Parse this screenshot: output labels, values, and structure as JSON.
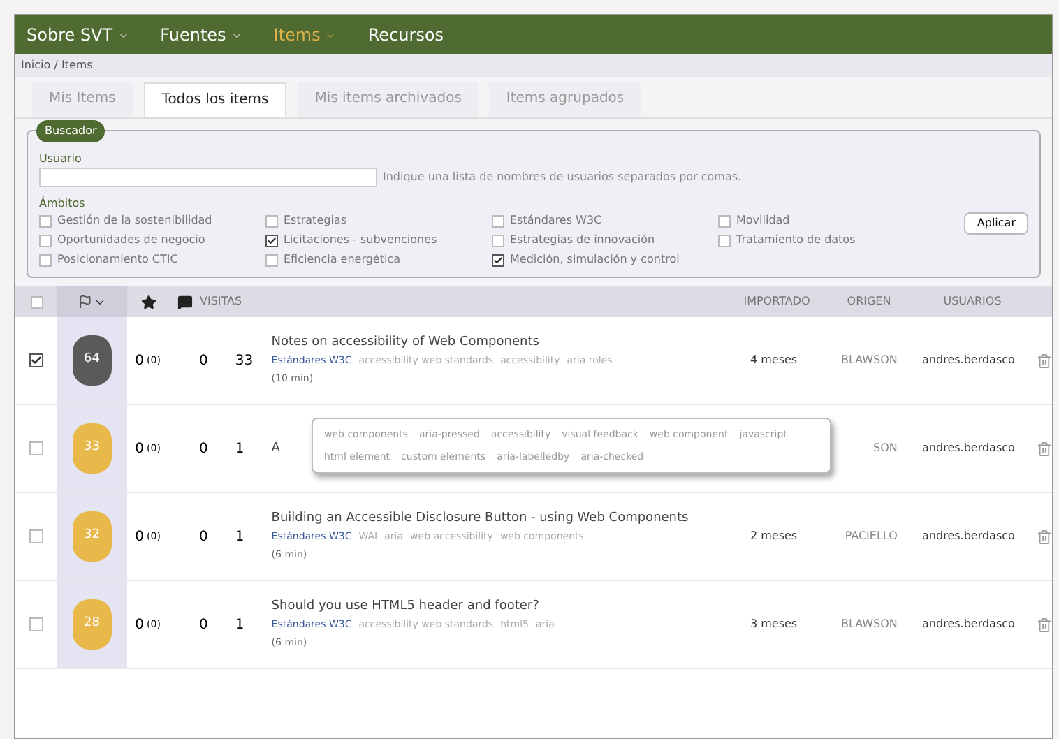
{
  "nav": [
    {
      "label": "Sobre SVT",
      "dropdown": true,
      "selected": false
    },
    {
      "label": "Fuentes",
      "dropdown": true,
      "selected": false
    },
    {
      "label": "Items",
      "dropdown": true,
      "selected": true
    },
    {
      "label": "Recursos",
      "dropdown": false,
      "selected": false
    }
  ],
  "breadcrumb": "Inicio / Items",
  "tabs": [
    {
      "label": "Mis Items",
      "selected": false
    },
    {
      "label": "Todos los items",
      "selected": true
    },
    {
      "label": "Mis items archivados",
      "selected": false
    },
    {
      "label": "Items agrupados",
      "selected": false
    }
  ],
  "search": {
    "legend": "Buscador",
    "user_label": "Usuario",
    "user_hint": "Indique una lista de nombres de usuarios separados por comas.",
    "scopes_label": "Ámbitos",
    "scopes": [
      [
        {
          "label": "Gestión de la sostenibilidad",
          "checked": false
        },
        {
          "label": "Oportunidades de negocio",
          "checked": false
        },
        {
          "label": "Posicionamiento CTIC",
          "checked": false
        }
      ],
      [
        {
          "label": "Estrategias",
          "checked": false
        },
        {
          "label": "Licitaciones - subvenciones",
          "checked": true
        },
        {
          "label": "Eficiencia energética",
          "checked": false
        }
      ],
      [
        {
          "label": "Estándares W3C",
          "checked": false
        },
        {
          "label": "Estrategias de innovación",
          "checked": false
        },
        {
          "label": "Medición, simulación y control",
          "checked": true
        }
      ],
      [
        {
          "label": "Movilidad",
          "checked": false
        },
        {
          "label": "Tratamiento de datos",
          "checked": false
        }
      ]
    ],
    "apply": "Aplicar"
  },
  "table": {
    "header_checked": false,
    "columns": {
      "visits": "VISITAS",
      "imported": "IMPORTADO",
      "origin": "ORIGEN",
      "users": "USUARIOS"
    },
    "rows": [
      {
        "checked": true,
        "score": "64",
        "color": "#5a5a5a",
        "rating": "0",
        "rating_count": "(0)",
        "comments": "0",
        "visits": "33",
        "title": "Notes on accessibility of Web Components",
        "tags": [
          {
            "label": "Estándares W3C",
            "kind": "scope"
          },
          {
            "label": "accessibility web standards",
            "kind": "tag"
          },
          {
            "label": "accessibility",
            "kind": "tag"
          },
          {
            "label": "aria roles",
            "kind": "tag"
          }
        ],
        "duration": "(10 min)",
        "imported": "4 meses",
        "origin": "BLAWSON",
        "user": "andres.berdasco"
      },
      {
        "checked": false,
        "score": "33",
        "color": "#e8b94a",
        "rating": "0",
        "rating_count": "(0)",
        "comments": "0",
        "visits": "1",
        "title": "A",
        "origin": "SON",
        "user": "andres.berdasco"
      },
      {
        "checked": false,
        "score": "32",
        "color": "#e8b94a",
        "rating": "0",
        "rating_count": "(0)",
        "comments": "0",
        "visits": "1",
        "title": "Building an Accessible Disclosure Button - using Web Components",
        "tags": [
          {
            "label": "Estándares W3C",
            "kind": "scope"
          },
          {
            "label": "WAI",
            "kind": "tag"
          },
          {
            "label": "aria",
            "kind": "tag"
          },
          {
            "label": "web accessibility",
            "kind": "tag"
          },
          {
            "label": "web components",
            "kind": "tag"
          }
        ],
        "duration": "(6 min)",
        "imported": "2 meses",
        "origin": "PACIELLO",
        "user": "andres.berdasco"
      },
      {
        "checked": false,
        "score": "28",
        "color": "#e8b94a",
        "rating": "0",
        "rating_count": "(0)",
        "comments": "0",
        "visits": "1",
        "title": "Should you use HTML5 header and footer?",
        "tags": [
          {
            "label": "Estándares W3C",
            "kind": "scope"
          },
          {
            "label": "accessibility web standards",
            "kind": "tag"
          },
          {
            "label": "html5",
            "kind": "tag"
          },
          {
            "label": "aria",
            "kind": "tag"
          }
        ],
        "duration": "(6 min)",
        "imported": "3 meses",
        "origin": "BLAWSON",
        "user": "andres.berdasco"
      }
    ],
    "popup_tags": [
      "web components",
      "aria-pressed",
      "accessibility",
      "visual feedback",
      "web component",
      "javascript",
      "html element",
      "custom elements",
      "aria-labelledby",
      "aria-checked"
    ]
  }
}
